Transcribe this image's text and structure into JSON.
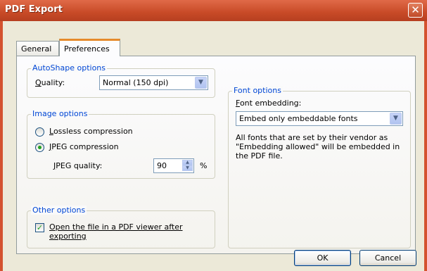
{
  "window": {
    "title": "PDF Export",
    "close_glyph": "✕",
    "titlebar_color": "#d4522f"
  },
  "tabs": [
    {
      "label": "General",
      "selected": false
    },
    {
      "label": "Preferences",
      "selected": true
    }
  ],
  "autoshape": {
    "legend": "AutoShape options",
    "quality_label_mnemonic": "Q",
    "quality_label_rest": "uality:",
    "quality_value": "Normal (150 dpi)"
  },
  "image": {
    "legend": "Image options",
    "lossless_mnemonic": "L",
    "lossless_rest": "ossless compression",
    "jpeg_mnemonic": "J",
    "jpeg_rest": "PEG compression",
    "selected": "jpeg",
    "jpeg_quality_mnemonic": "J",
    "jpeg_quality_rest": "PEG quality:",
    "jpeg_quality_value": "90",
    "jpeg_quality_unit": "%"
  },
  "other": {
    "legend": "Other options",
    "open_viewer_mnemonic": "O",
    "open_viewer_line1_rest": "pen the file in a PDF viewer after",
    "open_viewer_line2": "exporting",
    "open_viewer_checked": true
  },
  "font": {
    "legend": "Font options",
    "embedding_label_mnemonic": "F",
    "embedding_label_rest": "ont embedding:",
    "embedding_value": "Embed only embeddable fonts",
    "description_line1": "All fonts that are set by their vendor as",
    "description_line2": "\"Embedding allowed\" will be embedded in",
    "description_line3": "the PDF file."
  },
  "buttons": {
    "ok": "OK",
    "cancel": "Cancel"
  },
  "icons": {
    "dropdown": "chevron-down-icon",
    "close": "close-icon"
  }
}
